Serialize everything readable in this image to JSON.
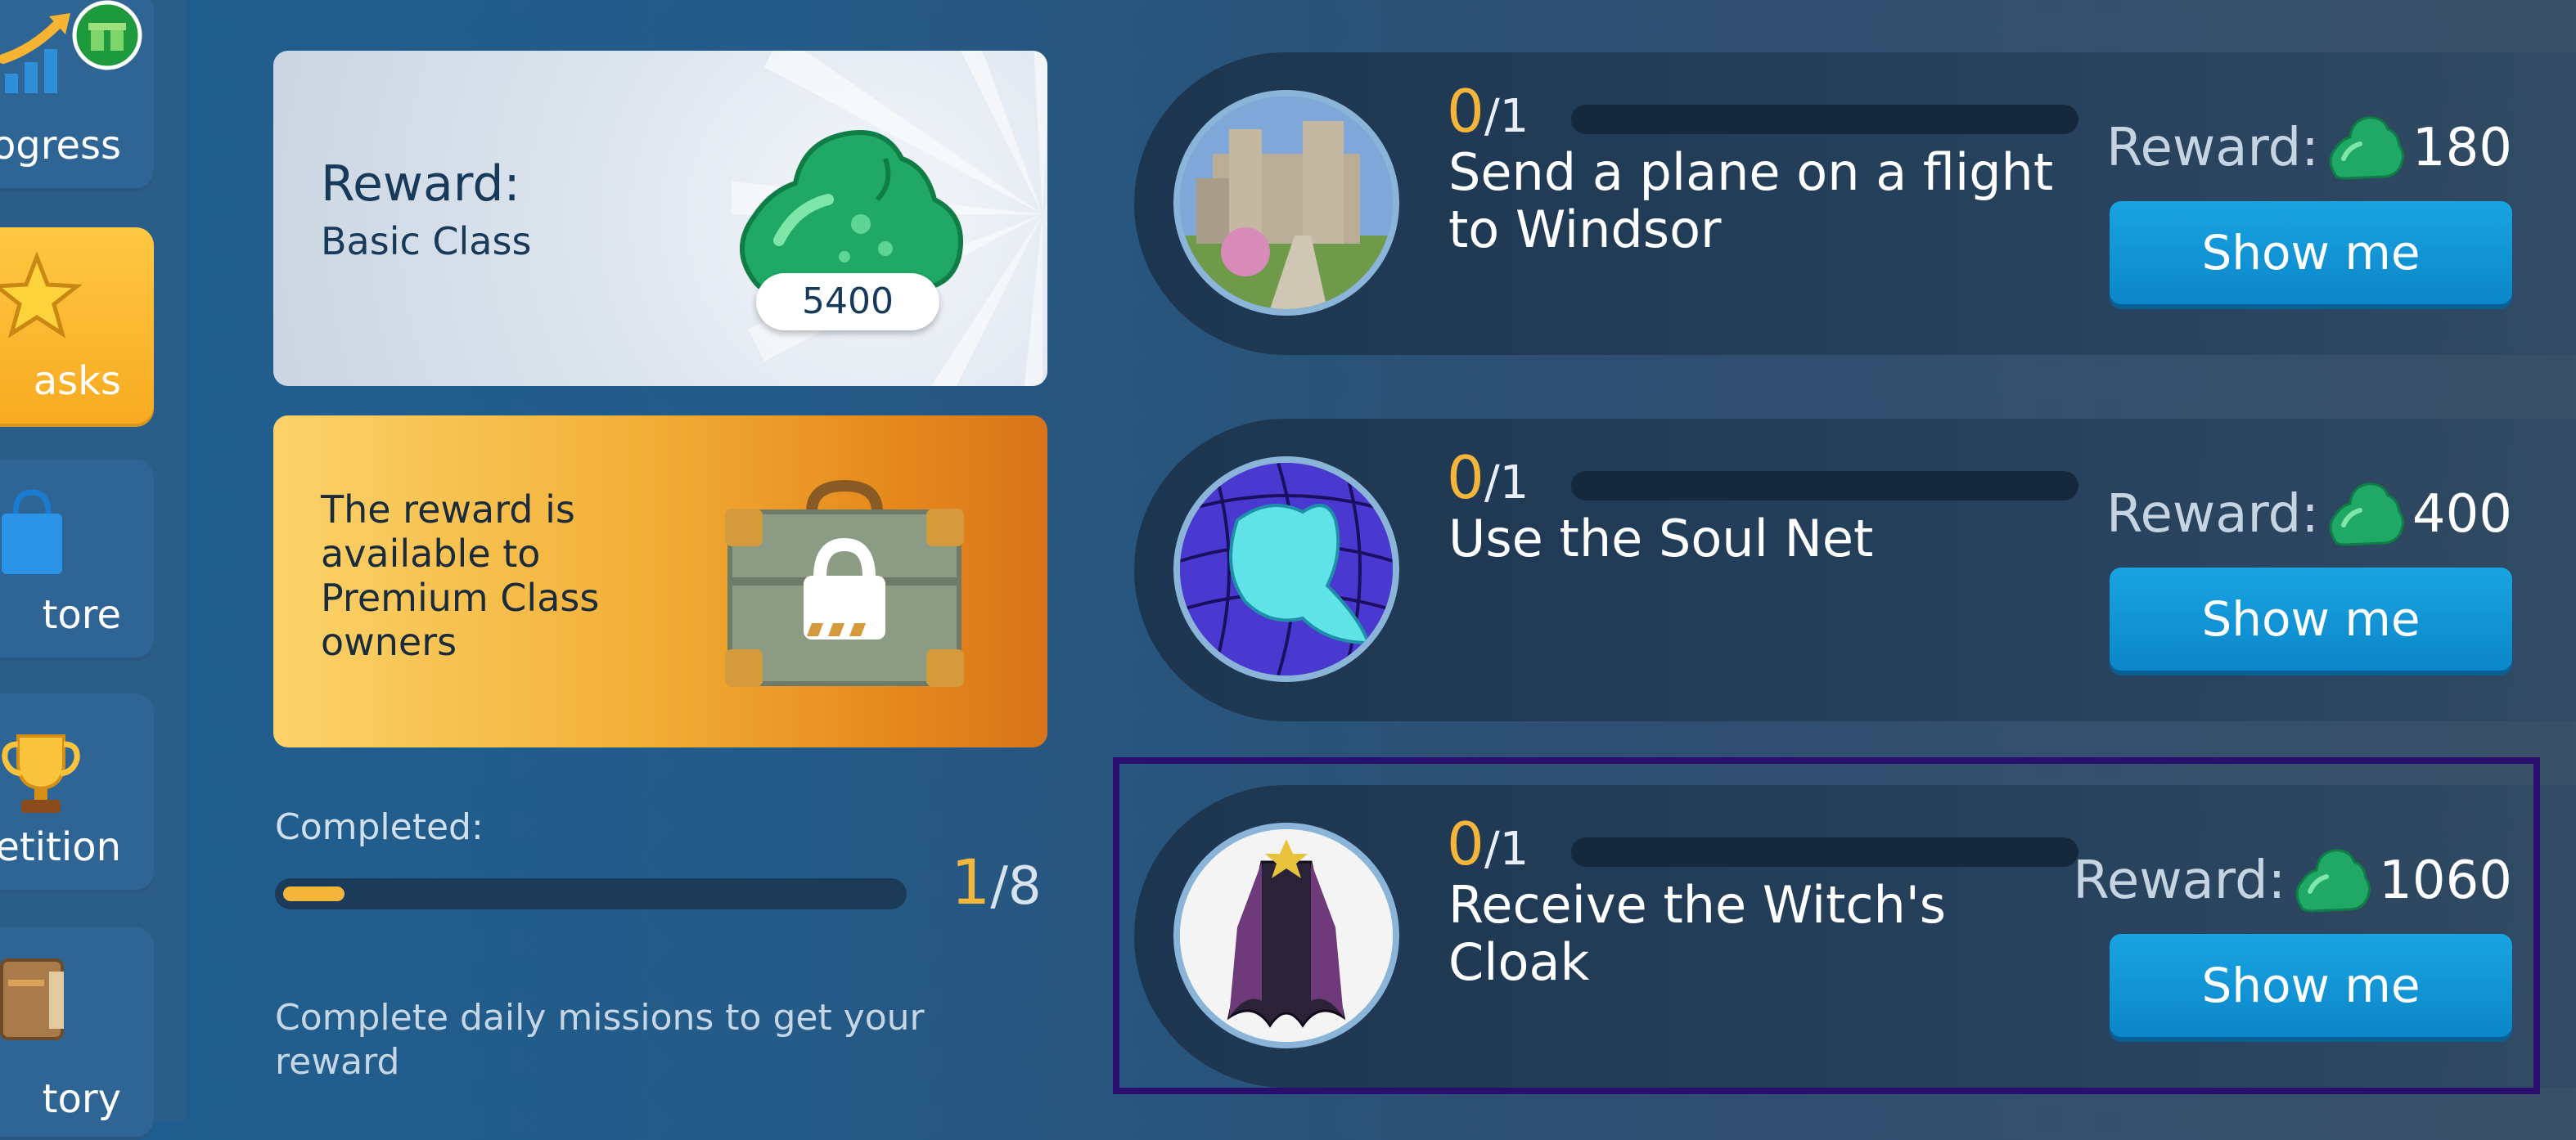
{
  "sidebar": {
    "items": [
      {
        "label": "ogress",
        "icon": "progress-chart-icon",
        "badge_icon": "gift-icon"
      },
      {
        "label": "asks",
        "icon": "star-icon",
        "active": true
      },
      {
        "label": "tore",
        "icon": "shopping-bag-icon"
      },
      {
        "label": "petition",
        "icon": "trophy-icon"
      },
      {
        "label": "tory",
        "icon": "book-icon"
      }
    ]
  },
  "reward_panel": {
    "title": "Reward:",
    "subtitle": "Basic Class",
    "amount": "5400",
    "icon": "green-slime-gem-icon"
  },
  "premium_panel": {
    "text": "The reward is available to Premium Class owners",
    "icon": "locked-chest-icon"
  },
  "completed": {
    "label": "Completed:",
    "done": "1",
    "total": "/8",
    "progress_fraction": 0.125
  },
  "footer_note": "Complete daily missions to get your reward",
  "missions": [
    {
      "progress": "0",
      "progress_total": "/1",
      "title": "Send a plane on a flight to Windsor",
      "reward_label": "Reward:",
      "reward_value": "180",
      "button": "Show me",
      "image": "windsor-castle"
    },
    {
      "progress": "0",
      "progress_total": "/1",
      "title": "Use the Soul Net",
      "reward_label": "Reward:",
      "reward_value": "400",
      "button": "Show me",
      "image": "soul-net"
    },
    {
      "progress": "0",
      "progress_total": "/1",
      "title": "Receive the Witch's Cloak",
      "reward_label": "Reward:",
      "reward_value": "1060",
      "button": "Show me",
      "image": "witch-cloak"
    }
  ],
  "colors": {
    "accent_orange": "#f4b53a",
    "button_blue": "#1aa4e2",
    "gem_green": "#2fb36b",
    "highlight": "#2a0f6e"
  }
}
